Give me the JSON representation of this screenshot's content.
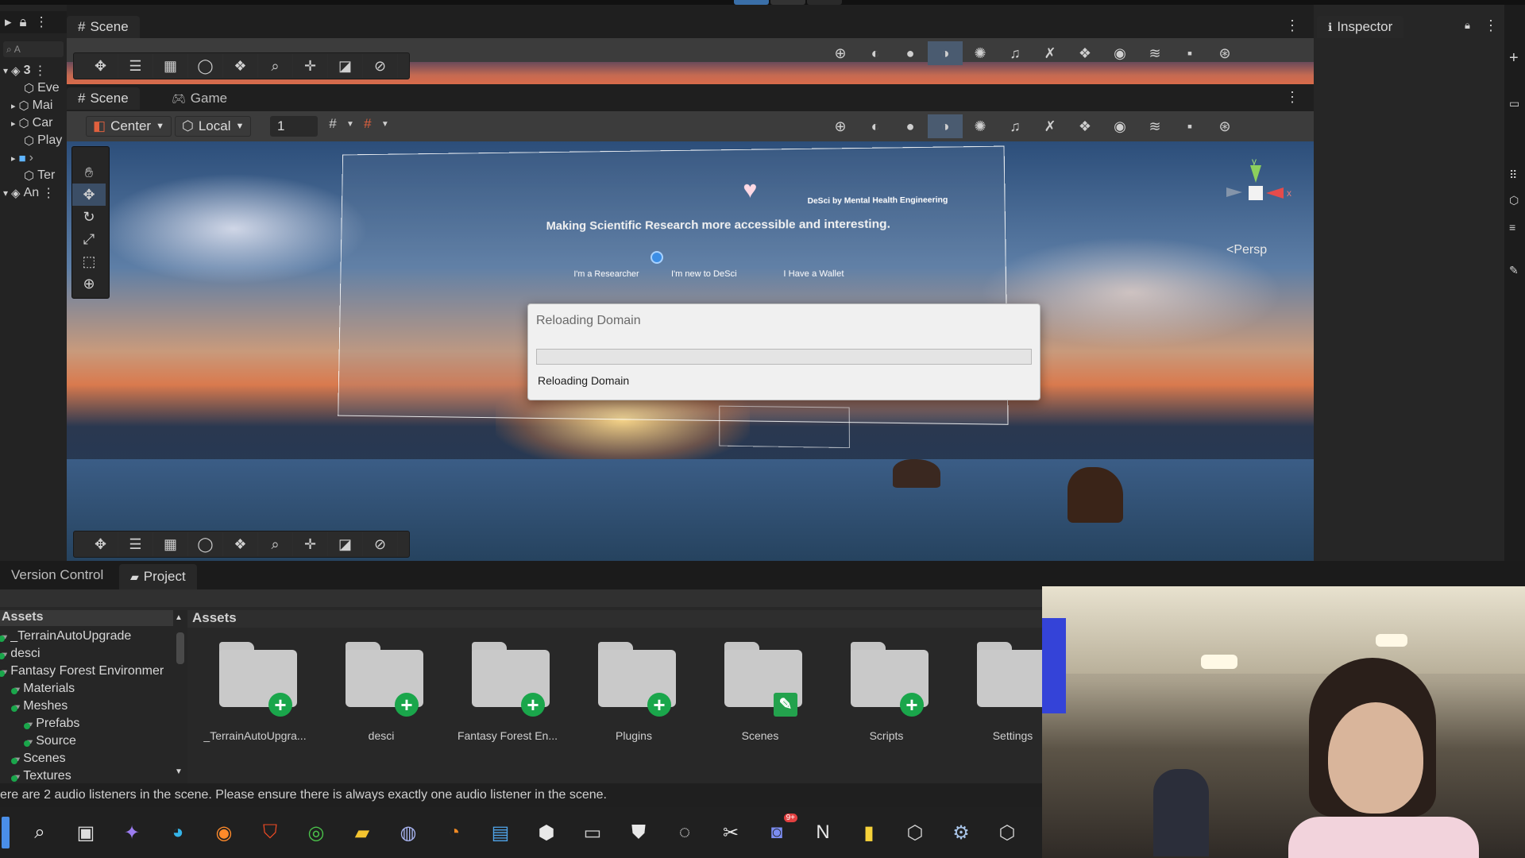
{
  "hierarchy": {
    "count_label": "3",
    "items": [
      "Eve",
      "Mai",
      "Car",
      "Play",
      "Ter",
      "An"
    ],
    "search_placeholder": "A"
  },
  "top_scene_tab": "Scene",
  "inspector_tab": "Inspector",
  "scene_panel": {
    "tabs": [
      "Scene",
      "Game"
    ],
    "pivot_label": "Center",
    "space_label": "Local",
    "grid_value": "1",
    "persp_label": "Persp",
    "gizmo_axis_y": "y",
    "gizmo_axis_x": "x"
  },
  "scene_content": {
    "headline": "Making Scientific Research more accessible and interesting.",
    "brand": "DeSci by Mental Health Engineering",
    "buttons": [
      "I'm a Researcher",
      "I'm new to DeSci",
      "I Have a Wallet"
    ]
  },
  "dialog": {
    "title": "Reloading Domain",
    "status": "Reloading Domain",
    "progress": 0
  },
  "bottom_tabs": [
    "Version Control",
    "Project"
  ],
  "project": {
    "tree_header": "Assets",
    "tree": [
      {
        "label": "_TerrainAutoUpgrade",
        "indent": 0
      },
      {
        "label": "desci",
        "indent": 0
      },
      {
        "label": "Fantasy Forest Environmer",
        "indent": 0
      },
      {
        "label": "Materials",
        "indent": 1
      },
      {
        "label": "Meshes",
        "indent": 1
      },
      {
        "label": "Prefabs",
        "indent": 2
      },
      {
        "label": "Source",
        "indent": 2
      },
      {
        "label": "Scenes",
        "indent": 1
      },
      {
        "label": "Textures",
        "indent": 1
      }
    ],
    "breadcrumb": "Assets",
    "folders": [
      {
        "label": "_TerrainAutoUpgra...",
        "badge": "add"
      },
      {
        "label": "desci",
        "badge": "add"
      },
      {
        "label": "Fantasy Forest En...",
        "badge": "add"
      },
      {
        "label": "Plugins",
        "badge": "add"
      },
      {
        "label": "Scenes",
        "badge": "edit"
      },
      {
        "label": "Scripts",
        "badge": "add"
      },
      {
        "label": "Settings",
        "badge": "none"
      }
    ]
  },
  "console_message": "ere are 2 audio listeners in the scene. Please ensure there is always exactly one audio listener in the scene.",
  "taskbar": {
    "icons": [
      "windows-start-icon",
      "search-icon",
      "task-view-icon",
      "copilot-icon",
      "edge-icon",
      "firefox-icon",
      "brave-icon",
      "chrome-icon",
      "file-explorer-icon",
      "app-icon",
      "blender-icon",
      "notepad-icon",
      "unity-hub-icon",
      "terminal-icon",
      "epic-icon",
      "github-icon",
      "capcut-icon",
      "discord-icon",
      "notion-icon",
      "sticky-notes-icon",
      "unity-icon",
      "settings-icon",
      "unity-editor-icon"
    ],
    "discord_badge": "9+"
  },
  "colors": {
    "accent_blue": "#3a7bd5",
    "badge_green": "#1aa64b",
    "panel": "#282828",
    "toolbar": "#3c3c3c"
  }
}
